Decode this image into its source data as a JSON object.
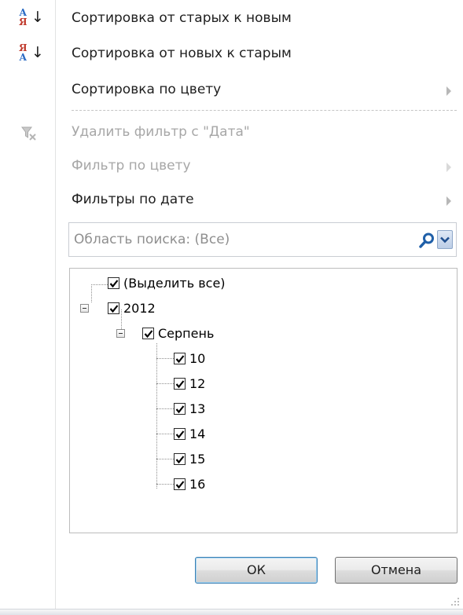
{
  "menu": {
    "sort_asc": "Сортировка от старых к новым",
    "sort_desc": "Сортировка от новых к старым",
    "sort_by_color": "Сортировка по цвету",
    "clear_filter": "Удалить фильтр с \"Дата\"",
    "filter_by_color": "Фильтр по цвету",
    "date_filters": "Фильтры по дате"
  },
  "icons": {
    "sort_asc": {
      "top": "А",
      "bottom": "Я",
      "arrow": "↓"
    },
    "sort_desc": {
      "top": "Я",
      "bottom": "А",
      "arrow": "↓"
    }
  },
  "search": {
    "placeholder": "Область поиска: (Все)",
    "value": ""
  },
  "tree": {
    "select_all": "(Выделить все)",
    "year": "2012",
    "month": "Серпень",
    "days": [
      "10",
      "12",
      "13",
      "14",
      "15",
      "16"
    ]
  },
  "buttons": {
    "ok": "ОК",
    "cancel": "Отмена"
  },
  "colors": {
    "sort_letter_top": "#2b6bc4",
    "sort_letter_bottom": "#c0392b",
    "disabled_text": "#a7a7a7",
    "search_icon": "#1f5fa8"
  }
}
